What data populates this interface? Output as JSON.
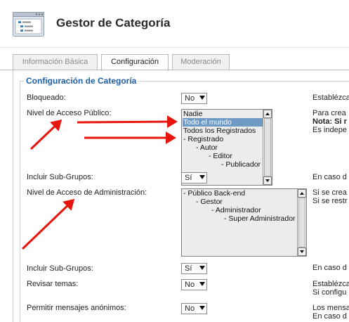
{
  "header": {
    "title": "Gestor de Categoría"
  },
  "tabs": [
    {
      "label": "Información Básica",
      "active": false
    },
    {
      "label": "Configuración",
      "active": true
    },
    {
      "label": "Moderación",
      "active": false
    }
  ],
  "section": {
    "legend": "Configuración de Categoría"
  },
  "fields": {
    "locked": {
      "label": "Bloqueado:",
      "value": "No",
      "desc": "Establézca"
    },
    "public_access": {
      "label": "Nivel de Acceso Público:",
      "options": [
        "Nadie",
        "Todo el mundo",
        "Todos los Registrados",
        "- Registrado",
        "- Autor",
        "- Editor",
        "- Publicador"
      ],
      "selected": "Todo el mundo",
      "desc": [
        "Para crea",
        "Nota: Si r",
        "Es indepe"
      ]
    },
    "public_subgroups": {
      "label": "Incluir Sub-Grupos:",
      "value": "Sí",
      "desc": "En caso d"
    },
    "admin_access": {
      "label": "Nivel de Acceso de Administración:",
      "options": [
        "- Público Back-end",
        "- Gestor",
        "- Administrador",
        "- Super Administrador"
      ],
      "desc": [
        "Si se crea",
        "Si se restr"
      ]
    },
    "admin_subgroups": {
      "label": "Incluir Sub-Grupos:",
      "value": "Sí",
      "desc": "En caso d"
    },
    "review": {
      "label": "Revisar temas:",
      "value": "No",
      "desc": [
        "Establézca",
        "Si configu"
      ]
    },
    "anonymous": {
      "label": "Permitir mensajes anónimos:",
      "value": "No",
      "desc": [
        "Los mensa",
        "En caso d"
      ]
    }
  },
  "colors": {
    "legend": "#1f5fa8",
    "selection": "#6e9ac4",
    "annotation_arrows": "#e8150f"
  },
  "icons": [
    "category-manager-icon"
  ]
}
